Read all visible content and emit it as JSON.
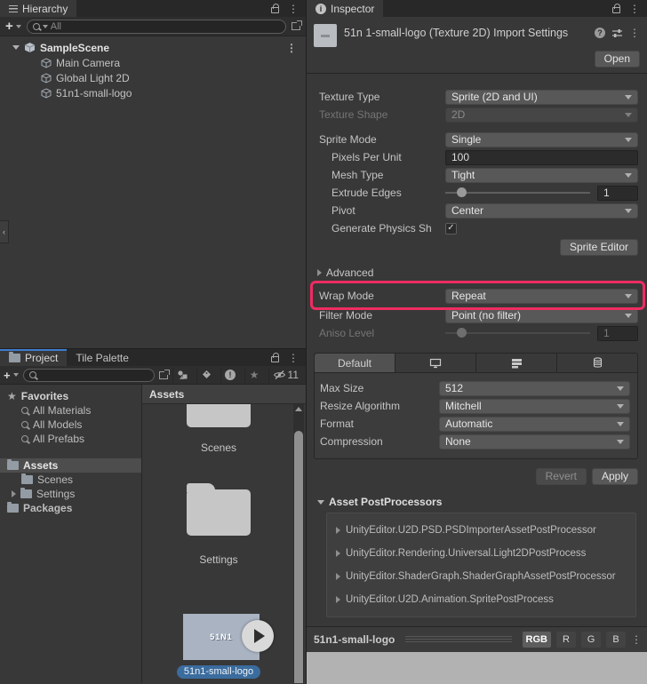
{
  "colors": {
    "accent_pink": "#ee2c62",
    "tab_accent_blue": "#3d7dce",
    "selected_label_blue": "#3b6c9e",
    "preview_bg": "#b2b2b2",
    "thumbnail_blue_gray": "#a9b3c2"
  },
  "hierarchy": {
    "tab_label": "Hierarchy",
    "search_placeholder": "All",
    "scene_name": "SampleScene",
    "items": [
      {
        "label": "Main Camera"
      },
      {
        "label": "Global Light 2D"
      },
      {
        "label": "51n1-small-logo"
      }
    ]
  },
  "project": {
    "tabs": [
      {
        "label": "Project"
      },
      {
        "label": "Tile Palette"
      }
    ],
    "hidden_count": "11",
    "favorites_label": "Favorites",
    "favorites": [
      {
        "label": "All Materials"
      },
      {
        "label": "All Models"
      },
      {
        "label": "All Prefabs"
      }
    ],
    "folders": [
      {
        "label": "Assets"
      },
      {
        "label": "Scenes"
      },
      {
        "label": "Settings"
      },
      {
        "label": "Packages"
      }
    ],
    "assets_header": "Assets",
    "grid": {
      "scenes_label": "Scenes",
      "settings_label": "Settings",
      "thumb_text": "51N1",
      "selected_label": "51n1-small-logo"
    }
  },
  "inspector": {
    "tab_label": "Inspector",
    "title": "51n 1-small-logo (Texture 2D) Import Settings",
    "open_button": "Open",
    "fields": {
      "texture_type": {
        "label": "Texture Type",
        "value": "Sprite (2D and UI)"
      },
      "texture_shape": {
        "label": "Texture Shape",
        "value": "2D"
      },
      "sprite_mode": {
        "label": "Sprite Mode",
        "value": "Single"
      },
      "pixels_per_unit": {
        "label": "Pixels Per Unit",
        "value": "100"
      },
      "mesh_type": {
        "label": "Mesh Type",
        "value": "Tight"
      },
      "extrude_edges": {
        "label": "Extrude Edges",
        "value": "1"
      },
      "pivot": {
        "label": "Pivot",
        "value": "Center"
      },
      "generate_physics": {
        "label": "Generate Physics Sh",
        "checked": "✓"
      },
      "wrap_mode": {
        "label": "Wrap Mode",
        "value": "Repeat"
      },
      "filter_mode": {
        "label": "Filter Mode",
        "value": "Point (no filter)"
      },
      "aniso_level": {
        "label": "Aniso Level",
        "value": "1"
      }
    },
    "sprite_editor_button": "Sprite Editor",
    "advanced_label": "Advanced",
    "platforms": {
      "default_tab": "Default",
      "fields": [
        {
          "label": "Max Size",
          "value": "512"
        },
        {
          "label": "Resize Algorithm",
          "value": "Mitchell"
        },
        {
          "label": "Format",
          "value": "Automatic"
        },
        {
          "label": "Compression",
          "value": "None"
        }
      ]
    },
    "revert_button": "Revert",
    "apply_button": "Apply",
    "postprocessors": {
      "title": "Asset PostProcessors",
      "items": [
        {
          "name": "UnityEditor.U2D.PSD.PSDImporterAssetPostProcessor"
        },
        {
          "name": "UnityEditor.Rendering.Universal.Light2DPostProcess"
        },
        {
          "name": "UnityEditor.ShaderGraph.ShaderGraphAssetPostProcessor"
        },
        {
          "name": "UnityEditor.U2D.Animation.SpritePostProcess"
        }
      ]
    },
    "preview": {
      "title": "51n1-small-logo",
      "channels": [
        {
          "label": "RGB"
        },
        {
          "label": "R"
        },
        {
          "label": "G"
        },
        {
          "label": "B"
        }
      ]
    }
  }
}
